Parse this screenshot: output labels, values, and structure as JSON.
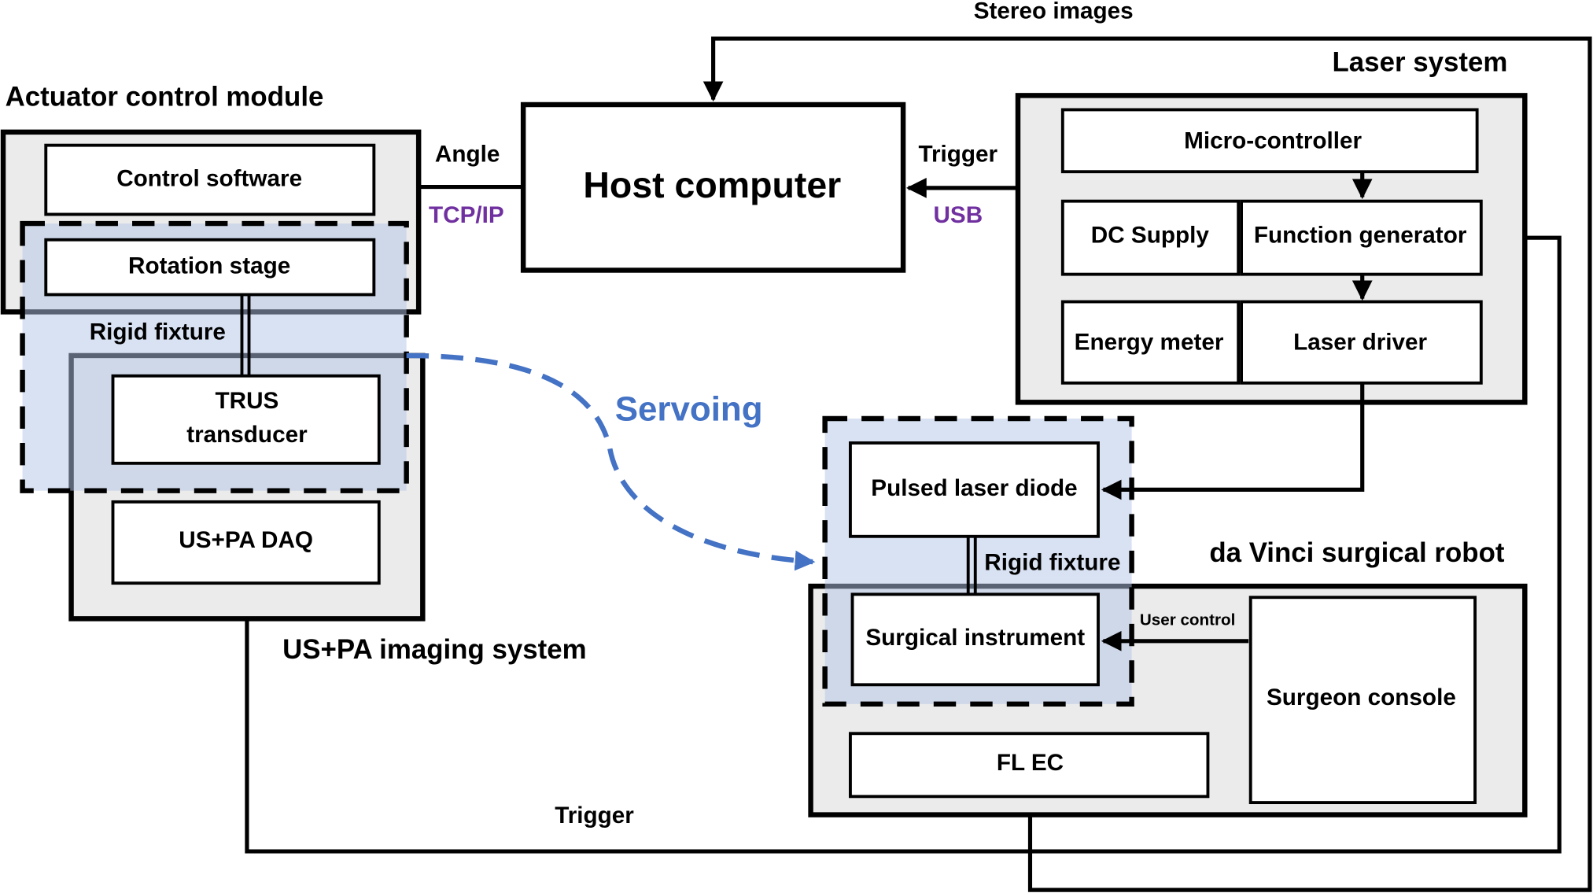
{
  "labels": {
    "stereo_images": "Stereo images",
    "host_computer": "Host computer",
    "angle": "Angle",
    "tcp_ip": "TCP/IP",
    "trigger_usb": "Trigger",
    "usb": "USB",
    "actuator_control_module": "Actuator control module",
    "control_software": "Control software",
    "rotation_stage": "Rotation stage",
    "rigid_fixture_left": "Rigid fixture",
    "trus_line1": "TRUS",
    "trus_line2": "transducer",
    "us_pa_daq": "US+PA DAQ",
    "us_pa_imaging_system": "US+PA imaging system",
    "servoing": "Servoing",
    "laser_system": "Laser system",
    "micro_controller": "Micro-controller",
    "dc_supply": "DC Supply",
    "function_generator": "Function generator",
    "energy_meter": "Energy meter",
    "laser_driver": "Laser driver",
    "pulsed_laser_diode": "Pulsed laser diode",
    "rigid_fixture_right": "Rigid fixture",
    "surgical_instrument": "Surgical instrument",
    "user_control": "User control",
    "surgeon_console": "Surgeon console",
    "fl_ec": "FL EC",
    "da_vinci": "da Vinci surgical robot",
    "trigger_bottom": "Trigger"
  },
  "colors": {
    "protocol": "#7030a0",
    "servoing": "#4472c4",
    "group_fill": "#ebebeb",
    "rigid_region": "#b4c5e8"
  }
}
